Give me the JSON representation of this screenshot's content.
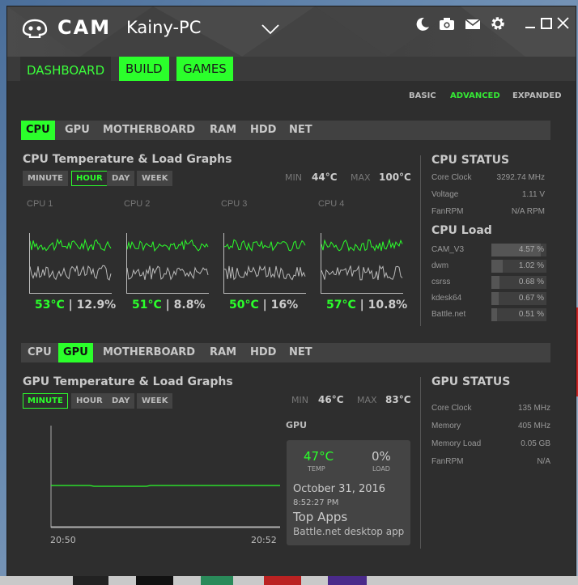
{
  "app": {
    "logo_text": "CAM",
    "pc_name": "Kainy-PC"
  },
  "titlebar_icons": [
    "moon-icon",
    "camera-icon",
    "mail-icon",
    "gear-icon",
    "minimize-icon",
    "maximize-icon",
    "close-icon"
  ],
  "nav": {
    "tabs": [
      "DASHBOARD",
      "BUILD",
      "GAMES"
    ],
    "active": "DASHBOARD"
  },
  "modes": {
    "items": [
      "BASIC",
      "ADVANCED",
      "EXPANDED"
    ],
    "active": "ADVANCED"
  },
  "subtabs": [
    "CPU",
    "GPU",
    "MOTHERBOARD",
    "RAM",
    "HDD",
    "NET"
  ],
  "cpu": {
    "active_tab": "CPU",
    "title": "CPU Temperature & Load Graphs",
    "ranges": [
      "MINUTE",
      "HOUR",
      "DAY",
      "WEEK"
    ],
    "active_range": "HOUR",
    "min_label": "MIN",
    "min_val": "44°C",
    "max_label": "MAX",
    "max_val": "100°C",
    "cores": [
      {
        "label": "CPU 1",
        "temp": "53°C",
        "load": "12.9%"
      },
      {
        "label": "CPU 2",
        "temp": "51°C",
        "load": "8.8%"
      },
      {
        "label": "CPU 3",
        "temp": "50°C",
        "load": "16%"
      },
      {
        "label": "CPU 4",
        "temp": "57°C",
        "load": "10.8%"
      }
    ],
    "status": {
      "title": "CPU STATUS",
      "rows": [
        {
          "label": "Core Clock",
          "value": "3292.74 MHz"
        },
        {
          "label": "Voltage",
          "value": "1.11 V"
        },
        {
          "label": "FanRPM",
          "value": "N/A RPM"
        }
      ]
    },
    "load": {
      "title": "CPU Load",
      "rows": [
        {
          "label": "CAM_V3",
          "value": "4.57 %",
          "frac": 0.9
        },
        {
          "label": "dwm",
          "value": "1.02 %",
          "frac": 0.2
        },
        {
          "label": "csrss",
          "value": "0.68 %",
          "frac": 0.14
        },
        {
          "label": "kdesk64",
          "value": "0.67 %",
          "frac": 0.13
        },
        {
          "label": "Battle.net",
          "value": "0.51 %",
          "frac": 0.1
        }
      ]
    }
  },
  "gpu": {
    "active_tab": "GPU",
    "title": "GPU Temperature & Load Graphs",
    "ranges": [
      "MINUTE",
      "HOUR",
      "DAY",
      "WEEK"
    ],
    "active_range": "MINUTE",
    "min_label": "MIN",
    "min_val": "46°C",
    "max_label": "MAX",
    "max_val": "83°C",
    "x_start": "20:50",
    "x_end": "20:52",
    "box": {
      "title": "GPU",
      "temp": "47°C",
      "temp_label": "TEMP",
      "load": "0%",
      "load_label": "LOAD",
      "date": "October 31, 2016",
      "time": "8:52:27 PM",
      "top_apps_label": "Top Apps",
      "top_app": "Battle.net desktop app"
    },
    "status": {
      "title": "GPU STATUS",
      "rows": [
        {
          "label": "Core Clock",
          "value": "135 MHz"
        },
        {
          "label": "Memory",
          "value": "405 MHz"
        },
        {
          "label": "Memory Load",
          "value": "0.05 GB"
        },
        {
          "label": "FanRPM",
          "value": "N/A"
        }
      ]
    }
  },
  "colors": {
    "accent": "#2bff2b",
    "bg": "#2e2e2e",
    "panel": "#414141"
  }
}
